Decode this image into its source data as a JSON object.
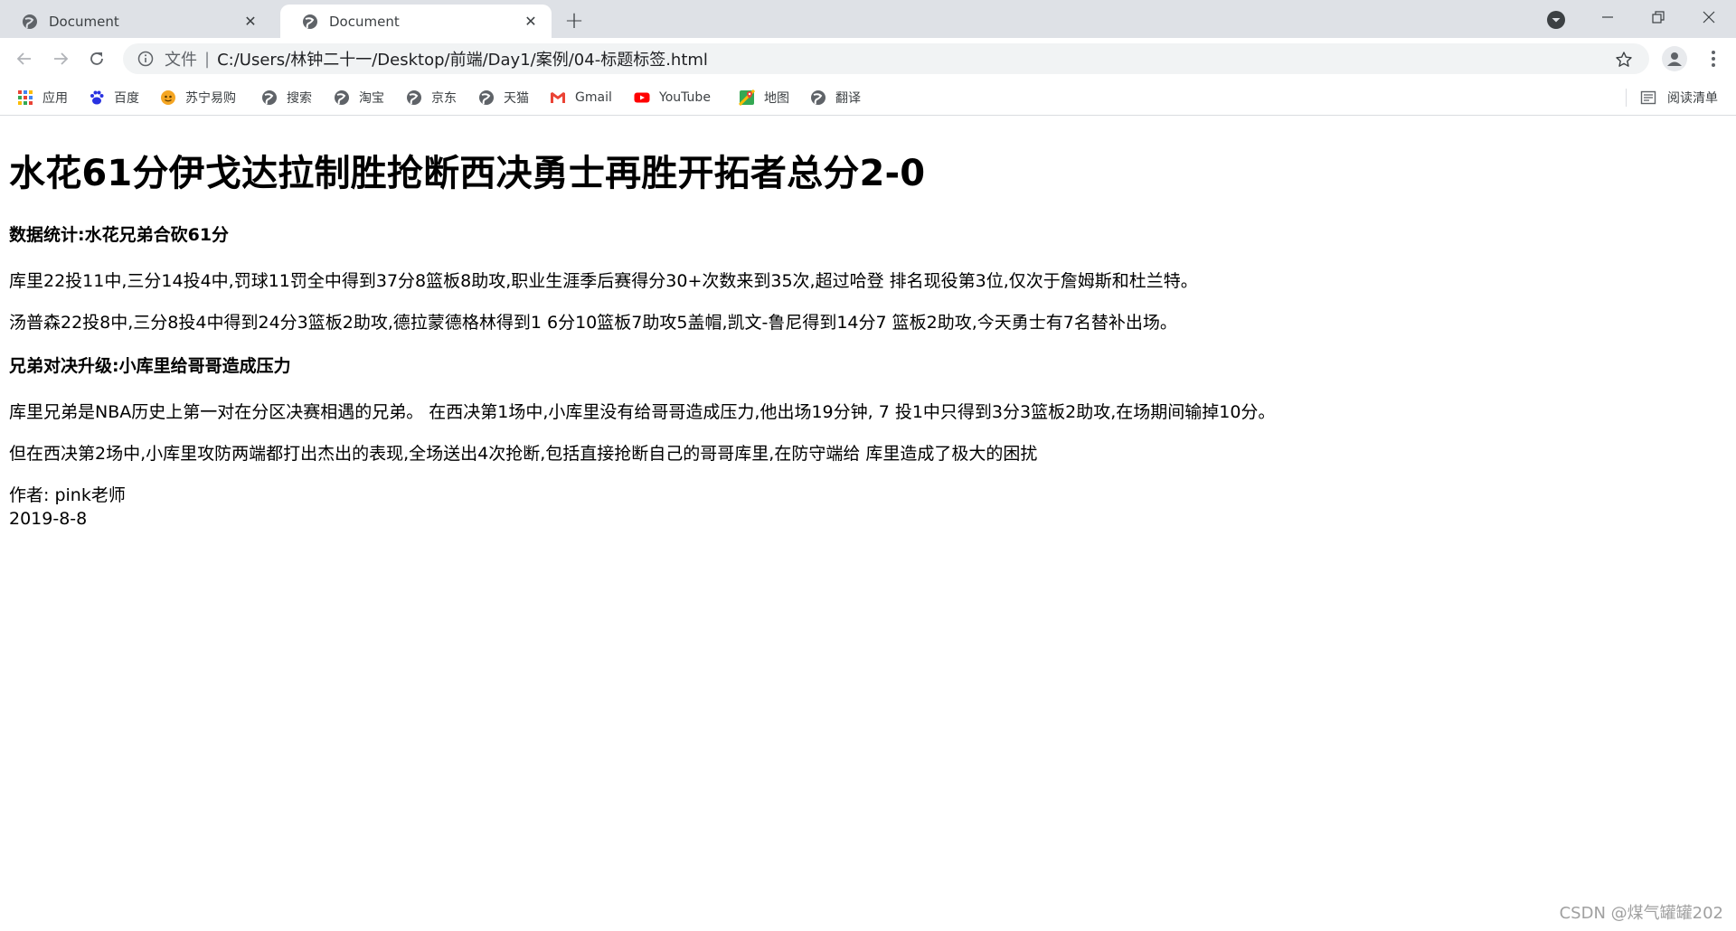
{
  "browser": {
    "tabs": [
      {
        "title": "Document",
        "active": false
      },
      {
        "title": "Document",
        "active": true
      }
    ],
    "new_tab_label": "+",
    "address_bar": {
      "scheme_label": "文件",
      "separator": "|",
      "url": "C:/Users/林钟二十一/Desktop/前端/Day1/案例/04-标题标签.html"
    },
    "bookmarks": [
      {
        "label": "应用",
        "icon": "apps-grid-icon"
      },
      {
        "label": "百度",
        "icon": "baidu-paw-icon"
      },
      {
        "label": "苏宁易购",
        "icon": "suning-icon"
      },
      {
        "label": "搜索",
        "icon": "globe-icon"
      },
      {
        "label": "淘宝",
        "icon": "globe-icon"
      },
      {
        "label": "京东",
        "icon": "globe-icon"
      },
      {
        "label": "天猫",
        "icon": "globe-icon"
      },
      {
        "label": "Gmail",
        "icon": "gmail-icon"
      },
      {
        "label": "YouTube",
        "icon": "youtube-icon"
      },
      {
        "label": "地图",
        "icon": "maps-icon"
      },
      {
        "label": "翻译",
        "icon": "globe-icon"
      }
    ],
    "reading_list_label": "阅读清单",
    "colors": {
      "tabstrip": "#dee1e6",
      "omnibox": "#f1f3f4"
    }
  },
  "page": {
    "title": "水花61分伊戈达拉制胜抢断西决勇士再胜开拓者总分2-0",
    "section1_heading": "数据统计:水花兄弟合砍61分",
    "section1_p1": "库里22投11中,三分14投4中,罚球11罚全中得到37分8篮板8助攻,职业生涯季后赛得分30+次数来到35次,超过哈登 排名现役第3位,仅次于詹姆斯和杜兰特。",
    "section1_p2": "汤普森22投8中,三分8投4中得到24分3篮板2助攻,德拉蒙德格林得到1 6分10篮板7助攻5盖帽,凯文-鲁尼得到14分7 篮板2助攻,今天勇士有7名替补出场。",
    "section2_heading": "兄弟对决升级:小库里给哥哥造成压力",
    "section2_p1": "库里兄弟是NBA历史上第一对在分区决赛相遇的兄弟。 在西决第1场中,小库里没有给哥哥造成压力,他出场19分钟, 7 投1中只得到3分3篮板2助攻,在场期间输掉10分。",
    "section2_p2": "但在西决第2场中,小库里攻防两端都打出杰出的表现,全场送出4次抢断,包括直接抢断自己的哥哥库里,在防守端给 库里造成了极大的困扰",
    "author": "作者: pink老师",
    "date": "2019-8-8"
  },
  "watermark": "CSDN @煤气罐罐202"
}
